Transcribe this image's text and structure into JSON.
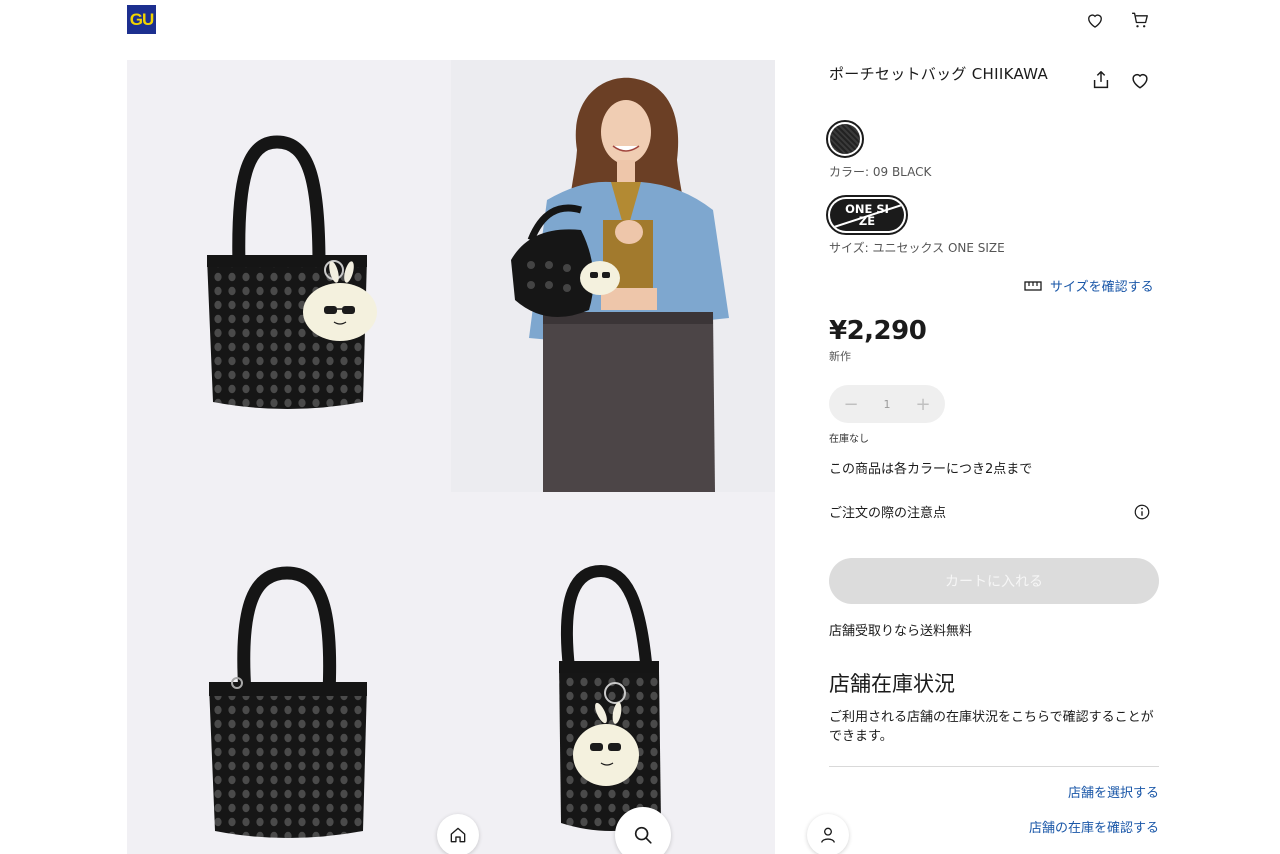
{
  "header": {
    "logo": "GU",
    "icons": [
      "heart-icon",
      "cart-icon"
    ]
  },
  "product": {
    "title": "ポーチセットバッグ CHIIKAWA",
    "color_label": "カラー: 09 BLACK",
    "size_chip": "ONE SIZE",
    "size_label": "サイズ: ユニセックス ONE SIZE",
    "size_check_link": "サイズを確認する",
    "price": "¥2,290",
    "badge": "新作",
    "quantity": "1",
    "stock_status": "在庫なし",
    "limit_notice": "この商品は各カラーにつき2点まで",
    "order_notes": "ご注文の際の注意点",
    "add_to_cart": "カートに入れる",
    "pickup_notice": "店舗受取りなら送料無料"
  },
  "store": {
    "heading": "店舗在庫状況",
    "description": "ご利用される店舗の在庫状況をこちらで確認することができます。",
    "select_store_link": "店舗を選択する",
    "check_stock_link": "店舗の在庫を確認する"
  },
  "colors": {
    "brand_blue": "#1c2f8f",
    "brand_yellow": "#f2d400",
    "link_blue": "#1a57a8",
    "disabled_button": "#dcdcdc"
  },
  "bottom_nav": [
    "home-icon",
    "search-icon",
    "user-icon"
  ]
}
